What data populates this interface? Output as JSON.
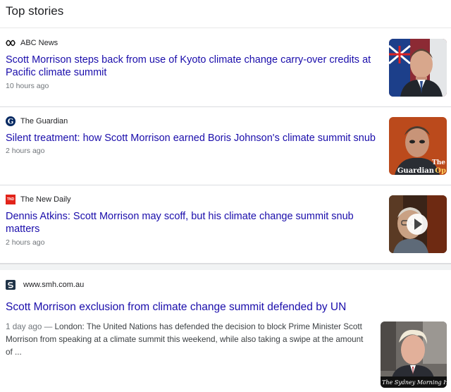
{
  "header": {
    "title": "Top stories"
  },
  "stories": [
    {
      "source": "ABC News",
      "source_logo": "abc-news-logo-icon",
      "headline": "Scott Morrison steps back from use of Kyoto climate change carry-over credits at Pacific climate summit",
      "time": "10 hours ago",
      "thumb": "scott-morrison-portrait"
    },
    {
      "source": "The Guardian",
      "source_logo": "the-guardian-logo-icon",
      "headline": "Silent treatment: how Scott Morrison earned Boris Johnson's climate summit snub",
      "time": "2 hours ago",
      "thumb": "scott-morrison-guardian-opinion",
      "thumb_overlay": [
        "The",
        "Guardian",
        "Op"
      ]
    },
    {
      "source": "The New Daily",
      "source_logo": "the-new-daily-logo-icon",
      "source_logo_text": "TND",
      "headline": "Dennis Atkins: Scott Morrison may scoff, but his climate change summit snub matters",
      "time": "2 hours ago",
      "thumb": "dennis-atkins-video",
      "thumb_icon": "play-icon"
    }
  ],
  "web_result": {
    "source": "www.smh.com.au",
    "source_logo": "smh-logo-icon",
    "headline": "Scott Morrison exclusion from climate change summit defended by UN",
    "time": "1 day ago",
    "separator": " — ",
    "snippet": "London: The United Nations has defended the decision to block Prime Minister Scott Morrison from speaking at a climate summit this weekend, while also taking a swipe at the amount of ...",
    "thumb": "boris-johnson-portrait",
    "thumb_overlay": "The Sydney Morning Hera"
  },
  "colors": {
    "link": "#1a0dab",
    "meta": "#70757a",
    "divider": "#dadce0",
    "tnd_red": "#e2231a",
    "guardian_navy": "#052962",
    "guardian_orange": "#ff7f0f"
  }
}
